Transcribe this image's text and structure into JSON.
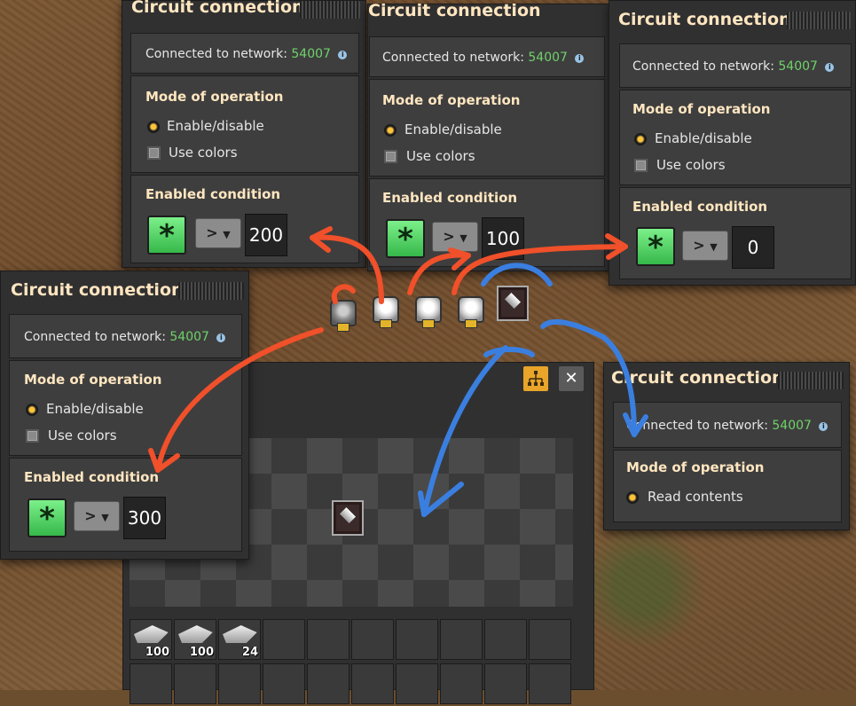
{
  "panels": [
    {
      "title": "Circuit connection",
      "network_label": "Connected to network:",
      "network_id": "54007",
      "mode_header": "Mode of operation",
      "mode_enable": "Enable/disable",
      "mode_colors": "Use colors",
      "condition_header": "Enabled condition",
      "comparator": ">",
      "value": "200"
    },
    {
      "title": "Circuit connection",
      "network_label": "Connected to network:",
      "network_id": "54007",
      "mode_header": "Mode of operation",
      "mode_enable": "Enable/disable",
      "mode_colors": "Use colors",
      "condition_header": "Enabled condition",
      "comparator": ">",
      "value": "100"
    },
    {
      "title": "Circuit connection",
      "network_label": "Connected to network:",
      "network_id": "54007",
      "mode_header": "Mode of operation",
      "mode_enable": "Enable/disable",
      "mode_colors": "Use colors",
      "condition_header": "Enabled condition",
      "comparator": ">",
      "value": "0"
    },
    {
      "title": "Circuit connection",
      "network_label": "Connected to network:",
      "network_id": "54007",
      "mode_header": "Mode of operation",
      "mode_enable": "Enable/disable",
      "mode_colors": "Use colors",
      "condition_header": "Enabled condition",
      "comparator": ">",
      "value": "300"
    }
  ],
  "chest_panel": {
    "title": "Circuit connection",
    "network_label": "Connected to network:",
    "network_id": "54007",
    "mode_header": "Mode of operation",
    "mode_read": "Read contents"
  },
  "inventory": [
    {
      "item": "iron-plate-icon",
      "count": "100"
    },
    {
      "item": "iron-plate-icon",
      "count": "100"
    },
    {
      "item": "iron-plate-icon",
      "count": "24"
    }
  ],
  "colors": {
    "network_id": "#6fd26a",
    "title": "#ffe6c0",
    "wire_red": "#f0502a",
    "wire_blue": "#3a7fe0",
    "signal_green": "#5ad86a"
  },
  "icons": {
    "signal": "*",
    "dropdown": "▼",
    "close": "✕",
    "network": "network-icon",
    "info": "i"
  }
}
